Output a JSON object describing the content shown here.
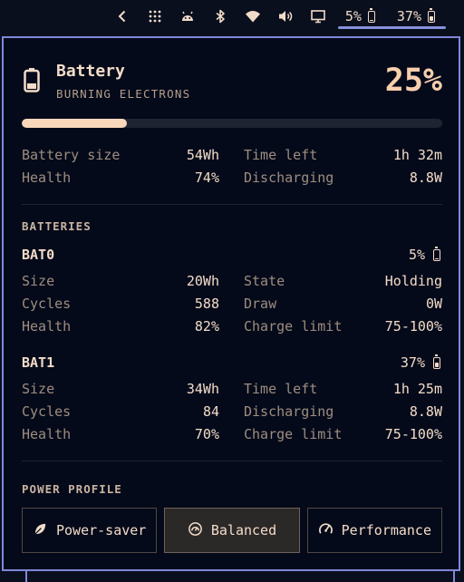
{
  "topbar": {
    "icons": [
      "chevron-left-icon",
      "dots-grid-icon",
      "robot-icon",
      "bluetooth-icon",
      "wifi-icon",
      "volume-icon",
      "display-icon"
    ],
    "battery_percents": [
      {
        "value": "5%",
        "level": 0.05
      },
      {
        "value": "37%",
        "level": 0.37
      }
    ]
  },
  "panel": {
    "title": "Battery",
    "subtitle": "BURNING ELECTRONS",
    "percent": "25%",
    "level": 0.25,
    "summary": {
      "battery_size_label": "Battery size",
      "battery_size": "54Wh",
      "time_left_label": "Time left",
      "time_left": "1h 32m",
      "health_label": "Health",
      "health": "74%",
      "discharging_label": "Discharging",
      "discharging": "8.8W"
    },
    "batteries_section": "BATTERIES",
    "batteries": [
      {
        "name": "BAT0",
        "percent": "5%",
        "level": 0.05,
        "size_label": "Size",
        "size": "20Wh",
        "right1_label": "State",
        "right1": "Holding",
        "cycles_label": "Cycles",
        "cycles": "588",
        "right2_label": "Draw",
        "right2": "0W",
        "health_label": "Health",
        "health": "82%",
        "right3_label": "Charge limit",
        "right3": "75-100%"
      },
      {
        "name": "BAT1",
        "percent": "37%",
        "level": 0.37,
        "size_label": "Size",
        "size": "34Wh",
        "right1_label": "Time left",
        "right1": "1h 25m",
        "cycles_label": "Cycles",
        "cycles": "84",
        "right2_label": "Discharging",
        "right2": "8.8W",
        "health_label": "Health",
        "health": "70%",
        "right3_label": "Charge limit",
        "right3": "75-100%"
      }
    ],
    "power_section": "POWER PROFILE",
    "profiles": [
      {
        "label": "Power-saver",
        "icon": "leaf-icon",
        "active": false
      },
      {
        "label": "Balanced",
        "icon": "gauge-icon",
        "active": true
      },
      {
        "label": "Performance",
        "icon": "speedometer-icon",
        "active": false
      }
    ]
  },
  "colors": {
    "background": "#050a1a",
    "accent_border": "#7f88da",
    "text": "#f2dcc8",
    "muted": "#9d8d80",
    "progress_fill": "#f8d7bb"
  }
}
